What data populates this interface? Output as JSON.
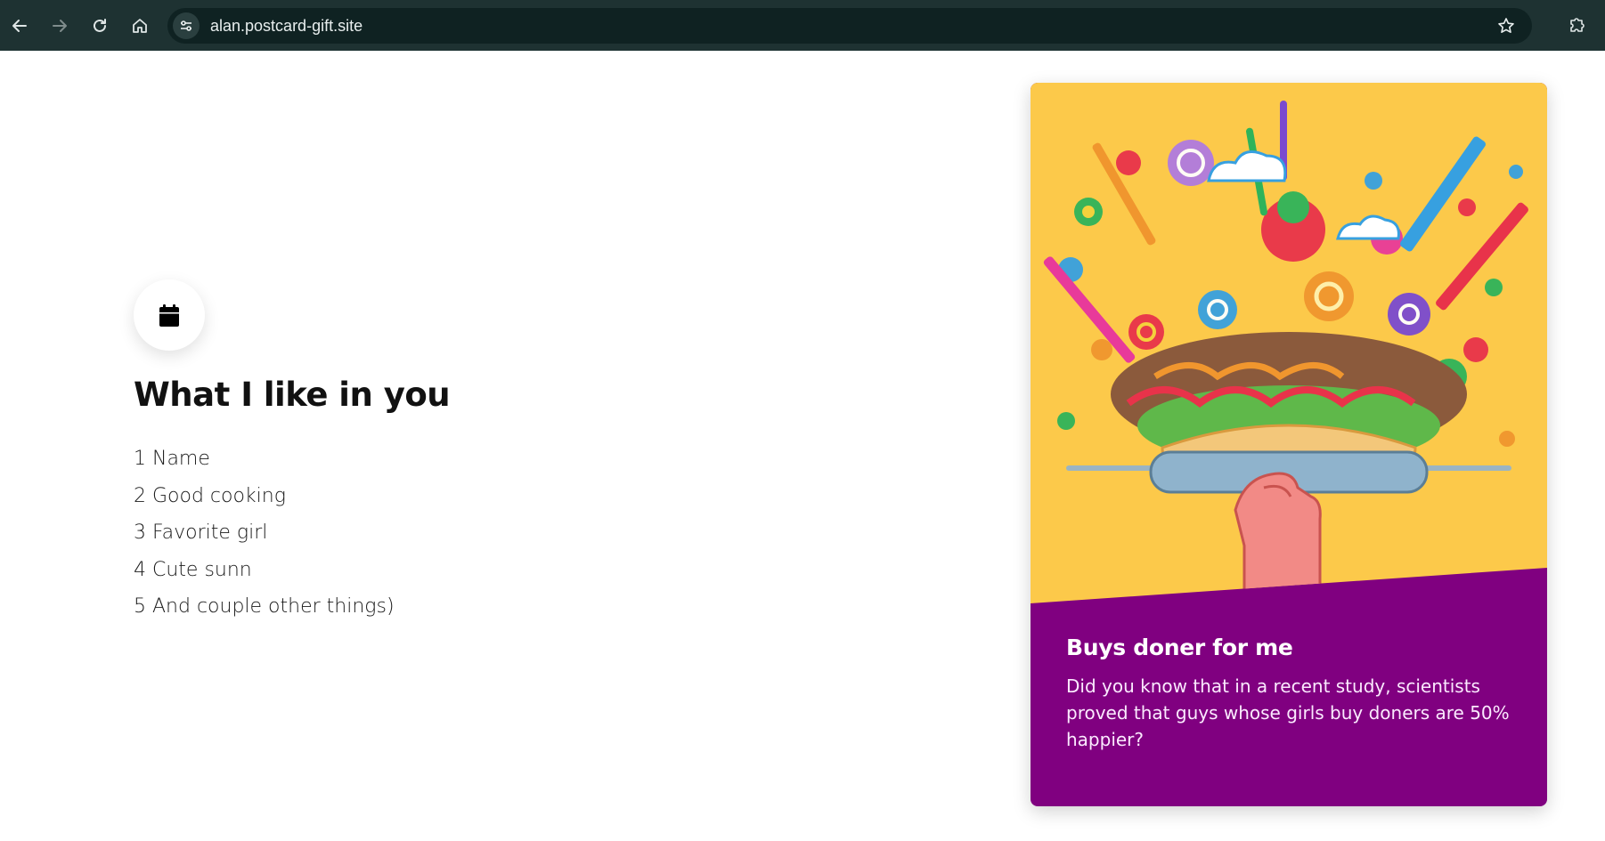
{
  "browser": {
    "url": "alan.postcard-gift.site",
    "back_icon": "arrow-left-icon",
    "forward_icon": "arrow-right-icon",
    "reload_icon": "reload-icon",
    "home_icon": "home-icon",
    "site_info_icon": "tune-icon",
    "bookmark_icon": "star-icon",
    "extensions_icon": "puzzle-icon"
  },
  "section": {
    "icon": "calendar-icon",
    "title": "What I like in you",
    "items": [
      "1 Name",
      "2 Good cooking",
      "3 Favorite girl",
      "4 Cute sunn",
      "5 And couple other things)"
    ]
  },
  "card": {
    "title": "Buys doner for me",
    "text": "Did you know that in a recent study, scientists proved that guys whose girls buy doners are 50% happier?",
    "image": "doner-illustration",
    "colors": {
      "background": "#800080",
      "image_bg": "#fcc94a"
    }
  }
}
